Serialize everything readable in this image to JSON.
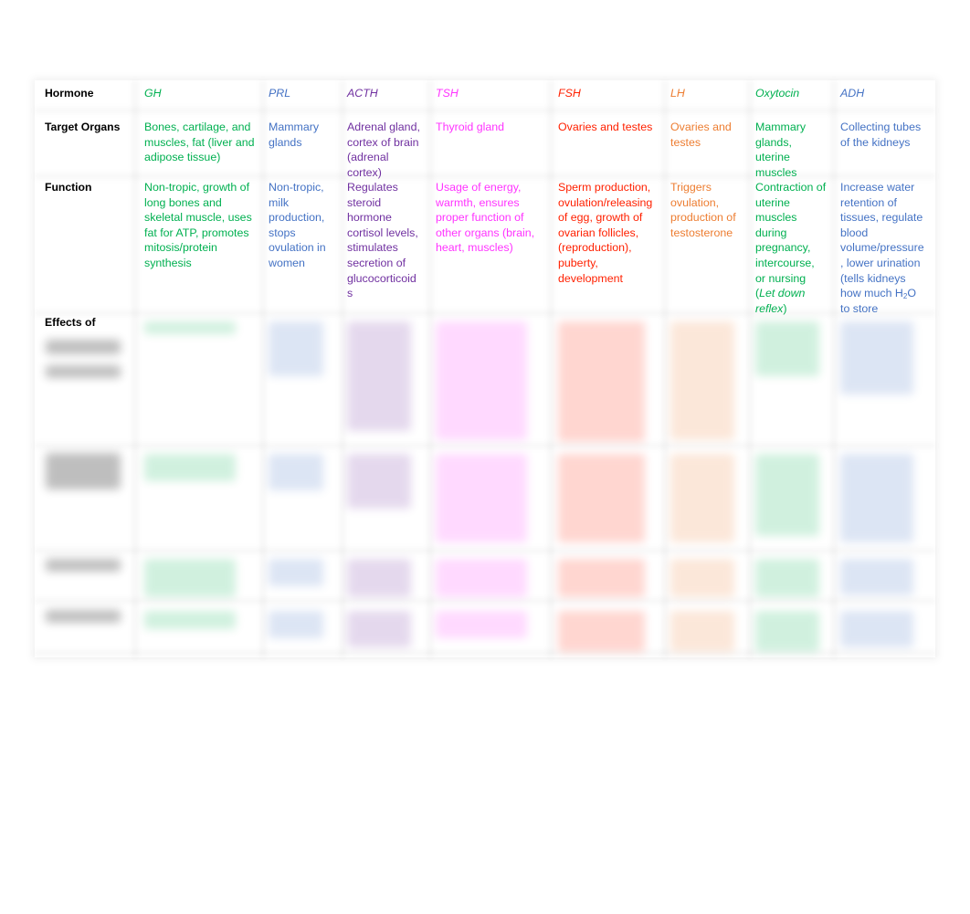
{
  "row_labels": {
    "hormone": "Hormone",
    "target": "Target Organs",
    "function": "Function",
    "effects": "Effects of"
  },
  "colors": {
    "GH": "#00b050",
    "PRL": "#4472c4",
    "ACTH": "#7030a0",
    "TSH": "#ff33ff",
    "FSH": "#ff2000",
    "LH": "#ed7d31",
    "Oxytocin": "#00b050",
    "ADH": "#4472c4"
  },
  "hormones": [
    {
      "name": "GH",
      "target": "Bones, cartilage, and\nmuscles, fat (liver and\nadipose tissue)",
      "function": "Non-tropic, growth of\nlong bones and\nskeletal muscle, uses\nfat for ATP, promotes\nmitosis/protein\nsynthesis"
    },
    {
      "name": "PRL",
      "target": "Mammary\nglands",
      "function": "Non-tropic,\nmilk\nproduction,\nstops\novulation in\nwomen"
    },
    {
      "name": "ACTH",
      "target": "Adrenal gland,\ncortex of brain\n(adrenal\ncortex)",
      "function": "Regulates\nsteroid\nhormone\ncortisol levels,\nstimulates\nsecretion of\nglucocorticoid\ns"
    },
    {
      "name": "TSH",
      "target": "Thyroid gland",
      "function": "Usage of energy,\nwarmth, ensures\nproper function of\nother organs (brain,\nheart, muscles)"
    },
    {
      "name": "FSH",
      "target": "Ovaries and testes",
      "function": "Sperm production,\novulation/releasing\nof egg, growth of\novarian follicles,\n(reproduction),\npuberty,\ndevelopment"
    },
    {
      "name": "LH",
      "target": "Ovaries and\ntestes",
      "function": "Triggers\novulation,\nproduction of\ntestosterone"
    },
    {
      "name": "Oxytocin",
      "target": "Mammary\nglands,\nuterine\nmuscles",
      "function": "Contraction of\nuterine\nmuscles\nduring\npregnancy,\nintercourse,\nor nursing\n(",
      "function_italic": "Let down\nreflex",
      "function_end": ")"
    },
    {
      "name": "ADH",
      "target": "Collecting tubes\nof the kidneys",
      "function": "Increase water\nretention of\ntissues, regulate\nblood\nvolume/pressure\n, lower urination\n(tells kidneys\nhow much H",
      "function_sub": "2",
      "function_end": "O\nto store"
    }
  ]
}
